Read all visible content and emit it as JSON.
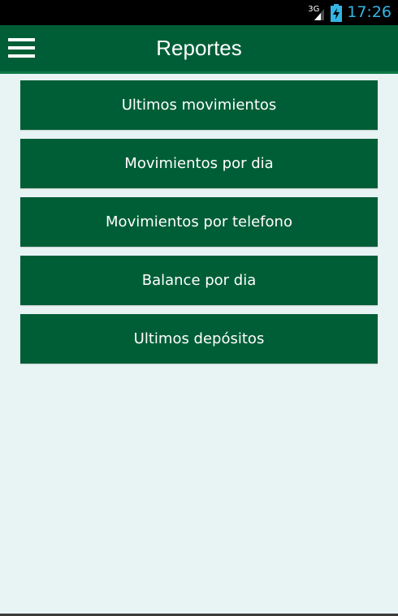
{
  "status_bar": {
    "network": "3G",
    "time": "17:26",
    "icons": [
      "signal-icon",
      "battery-charging-icon"
    ],
    "time_color": "#33b5e5"
  },
  "app_bar": {
    "title": "Reportes",
    "menu_icon": "hamburger-menu-icon",
    "background": "#005e36"
  },
  "reports": [
    {
      "label": "Ultimos movimientos"
    },
    {
      "label": "Movimientos por dia"
    },
    {
      "label": "Movimientos por telefono"
    },
    {
      "label": "Balance por dia"
    },
    {
      "label": "Ultimos depósitos"
    }
  ],
  "colors": {
    "button": "#005e36",
    "background": "#e8f3f4"
  }
}
